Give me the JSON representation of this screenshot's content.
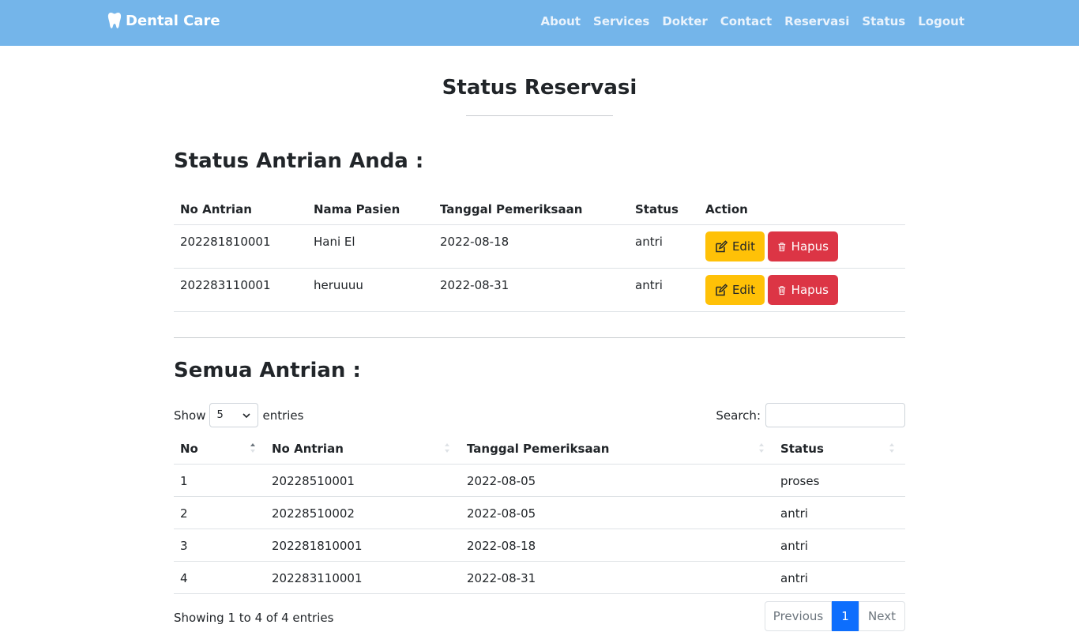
{
  "navbar": {
    "brand": "Dental Care",
    "links": [
      "About",
      "Services",
      "Dokter",
      "Contact",
      "Reservasi",
      "Status",
      "Logout"
    ]
  },
  "page_title": "Status Reservasi",
  "your_queue": {
    "heading": "Status Antrian Anda :",
    "columns": [
      "No Antrian",
      "Nama Pasien",
      "Tanggal Pemeriksaan",
      "Status",
      "Action"
    ],
    "rows": [
      {
        "no": "202281810001",
        "name": "Hani El",
        "date": "2022-08-18",
        "status": "antri"
      },
      {
        "no": "202283110001",
        "name": "heruuuu",
        "date": "2022-08-31",
        "status": "antri"
      }
    ],
    "edit_label": "Edit",
    "delete_label": "Hapus"
  },
  "all_queue": {
    "heading": "Semua Antrian :",
    "show_label": "Show",
    "show_value": "5",
    "entries_label": "entries",
    "search_label": "Search:",
    "search_value": "",
    "columns": [
      "No",
      "No Antrian",
      "Tanggal Pemeriksaan",
      "Status"
    ],
    "rows": [
      {
        "no": "1",
        "queue": "20228510001",
        "date": "2022-08-05",
        "status": "proses"
      },
      {
        "no": "2",
        "queue": "20228510002",
        "date": "2022-08-05",
        "status": "antri"
      },
      {
        "no": "3",
        "queue": "202281810001",
        "date": "2022-08-18",
        "status": "antri"
      },
      {
        "no": "4",
        "queue": "202283110001",
        "date": "2022-08-31",
        "status": "antri"
      }
    ],
    "info": "Showing 1 to 4 of 4 entries",
    "pagination": {
      "previous": "Previous",
      "current": "1",
      "next": "Next"
    }
  },
  "colors": {
    "navbar": "#74b5ea",
    "edit_button": "#ffc107",
    "delete_button": "#dc3545",
    "active_page": "#0d6efd"
  },
  "icons": {
    "brand": "tooth-icon",
    "edit": "edit-icon",
    "delete": "trash-icon",
    "select": "chevron-down-icon",
    "sort": "sort-icon"
  }
}
